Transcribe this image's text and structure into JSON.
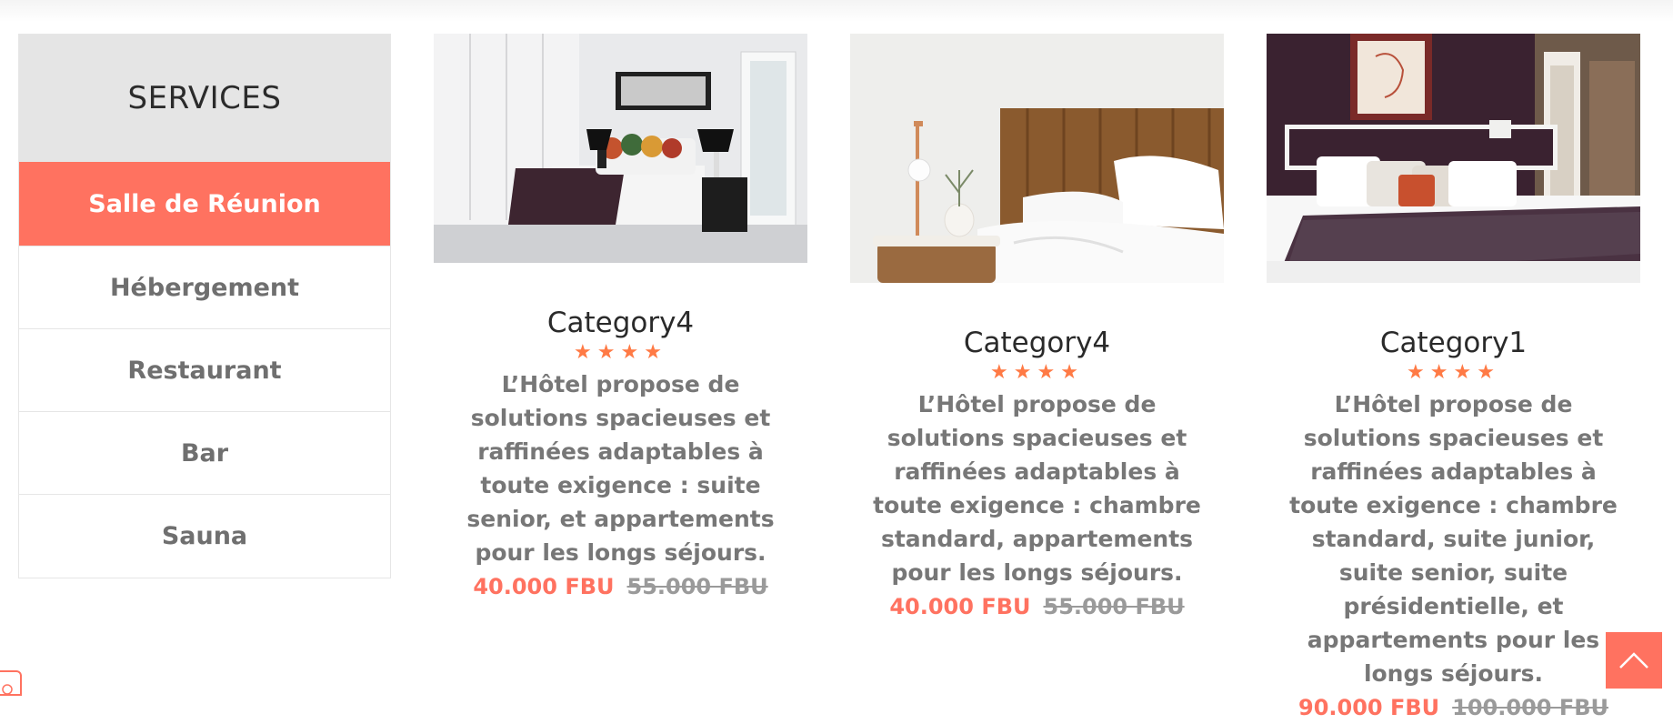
{
  "sidebar": {
    "title": "SERVICES",
    "items": [
      {
        "label": "Salle de Réunion",
        "active": true
      },
      {
        "label": "Hébergement",
        "active": false
      },
      {
        "label": "Restaurant",
        "active": false
      },
      {
        "label": "Bar",
        "active": false
      },
      {
        "label": "Sauna",
        "active": false
      }
    ]
  },
  "cards": [
    {
      "title": "Category4",
      "stars": "★★★★",
      "rating": 4,
      "description": "L’Hôtel propose de solutions spacieuses et raffinées adaptables à toute exigence : suite senior, et appartements pour les longs séjours.",
      "price": "40.000 FBU",
      "old_price": "55.000 FBU"
    },
    {
      "title": "Category4",
      "stars": "★★★★",
      "rating": 4,
      "description": "L’Hôtel propose de solutions spacieuses et raffinées adaptables à toute exigence : chambre standard, appartements pour les longs séjours.",
      "price": "40.000 FBU",
      "old_price": "55.000 FBU"
    },
    {
      "title": "Category1",
      "stars": "★★★★",
      "rating": 4,
      "description": "L’Hôtel propose de solutions spacieuses et raffinées adaptables à toute exigence : chambre standard, suite junior, suite senior, suite présidentielle, et appartements pour les longs séjours.",
      "price": "90.000 FBU",
      "old_price": "100.000 FBU"
    }
  ],
  "colors": {
    "accent": "#ff7260",
    "star": "#ff7a45",
    "sidebar_header_bg": "#e5e5e5"
  },
  "icons": {
    "scroll_top": "chevron-up-icon",
    "corner_widget": "chat-widget-icon"
  }
}
